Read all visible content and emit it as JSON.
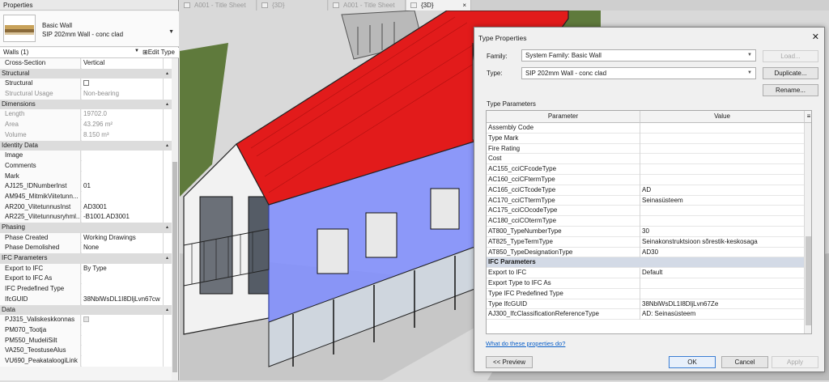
{
  "properties": {
    "title": "Properties",
    "type_name_line1": "Basic Wall",
    "type_name_line2": "SIP 202mm Wall - conc clad",
    "filter": "Walls (1)",
    "edit_type": "Edit Type",
    "rows": [
      {
        "k": "Cross-Section",
        "v": "Vertical"
      },
      {
        "cat": "Structural"
      },
      {
        "k": "Structural",
        "check": true
      },
      {
        "k": "Structural Usage",
        "v": "Non-bearing",
        "dim": true
      },
      {
        "cat": "Dimensions"
      },
      {
        "k": "Length",
        "v": "19702.0",
        "dim": true
      },
      {
        "k": "Area",
        "v": "43.296 m²",
        "dim": true
      },
      {
        "k": "Volume",
        "v": "8.150 m³",
        "dim": true
      },
      {
        "cat": "Identity Data"
      },
      {
        "k": "Image",
        "v": ""
      },
      {
        "k": "Comments",
        "v": ""
      },
      {
        "k": "Mark",
        "v": ""
      },
      {
        "k": "AJ125_IDNumberInst",
        "v": "01"
      },
      {
        "k": "AM945_MitmikViitetunn...",
        "v": ""
      },
      {
        "k": "AR200_ViitetunnusInst",
        "v": "AD3001"
      },
      {
        "k": "AR225_Viitetunnusryhml...",
        "v": "-B1001.AD3001"
      },
      {
        "cat": "Phasing"
      },
      {
        "k": "Phase Created",
        "v": "Working Drawings"
      },
      {
        "k": "Phase Demolished",
        "v": "None"
      },
      {
        "cat": "IFC Parameters"
      },
      {
        "k": "Export to IFC",
        "v": "By Type"
      },
      {
        "k": "Export to IFC As",
        "v": ""
      },
      {
        "k": "IFC Predefined Type",
        "v": ""
      },
      {
        "k": "IfcGUID",
        "v": "38NblWsDL1I8DljLvn67cw"
      },
      {
        "cat": "Data"
      },
      {
        "k": "PJ315_Valiskeskkonnas",
        "check": true,
        "checkDisabled": true
      },
      {
        "k": "PM070_Tootja",
        "v": ""
      },
      {
        "k": "PM550_MudeliSilt",
        "v": ""
      },
      {
        "k": "VA250_TeostuseAlus",
        "v": ""
      },
      {
        "k": "VU690_PeakataloogiLink",
        "v": ""
      }
    ]
  },
  "tabs": [
    {
      "label": "A001 - Title Sheet",
      "active": false
    },
    {
      "label": "{3D}",
      "active": false
    },
    {
      "label": "A001 - Title Sheet",
      "active": false
    },
    {
      "label": "{3D}",
      "active": true
    }
  ],
  "dialog": {
    "title": "Type Properties",
    "family_label": "Family:",
    "family_value": "System Family: Basic Wall",
    "type_label": "Type:",
    "type_value": "SIP 202mm Wall - conc clad",
    "load": "Load...",
    "duplicate": "Duplicate...",
    "rename": "Rename...",
    "type_parameters": "Type Parameters",
    "col_param": "Parameter",
    "col_value": "Value",
    "rows": [
      {
        "p": "Assembly Code",
        "v": ""
      },
      {
        "p": "Type Mark",
        "v": ""
      },
      {
        "p": "Fire Rating",
        "v": ""
      },
      {
        "p": "Cost",
        "v": ""
      },
      {
        "p": "AC155_cciCFcodeType",
        "v": ""
      },
      {
        "p": "AC160_cciCFtermType",
        "v": ""
      },
      {
        "p": "AC165_cciCTcodeType",
        "v": "AD"
      },
      {
        "p": "AC170_cciCTtermType",
        "v": "Seinasüsteem"
      },
      {
        "p": "AC175_cciCOcodeType",
        "v": ""
      },
      {
        "p": "AC180_cciCOtermType",
        "v": ""
      },
      {
        "p": "AT800_TypeNumberType",
        "v": "30"
      },
      {
        "p": "AT825_TypeTermType",
        "v": "Seinakonstruktsioon sõrestik-keskosaga"
      },
      {
        "p": "AT850_TypeDesignationType",
        "v": "AD30"
      },
      {
        "grp": "IFC Parameters"
      },
      {
        "p": "Export to IFC",
        "v": "Default"
      },
      {
        "p": "Export Type to IFC As",
        "v": ""
      },
      {
        "p": "Type IFC Predefined Type",
        "v": ""
      },
      {
        "p": "Type IfcGUID",
        "v": "38NblWsDL1I8DljLvn67Ze"
      },
      {
        "p": "AJ300_IfcClassificationReferenceType",
        "v": "AD: Seinasüsteem"
      }
    ],
    "link": "What do these properties do?",
    "preview": "<< Preview",
    "ok": "OK",
    "cancel": "Cancel",
    "apply": "Apply"
  },
  "colors": {
    "roof": "#e21b1b",
    "selection": "#7f8dff",
    "grass": "#5f7a3c"
  }
}
